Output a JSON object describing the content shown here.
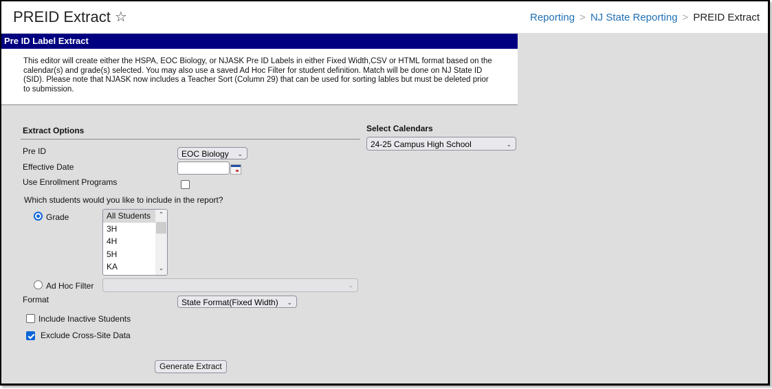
{
  "header": {
    "title": "PREID Extract",
    "favorite_icon": "star-outline-icon",
    "breadcrumb": [
      {
        "label": "Reporting",
        "link": true
      },
      {
        "label": "NJ State Reporting",
        "link": true
      },
      {
        "label": "PREID Extract",
        "link": false
      }
    ],
    "breadcrumb_separator": ">"
  },
  "banner": {
    "title": "Pre ID Label Extract"
  },
  "description": "This editor will create either the HSPA, EOC Biology, or NJASK Pre ID Labels in either Fixed Width,CSV or HTML format based on the calendar(s) and grade(s) selected. You may also use a saved Ad Hoc Filter for student definition. Match will be done on NJ State ID (SID). Please note that NJASK now includes a Teacher Sort (Column 29) that can be used for sorting lables but must be deleted prior to submission.",
  "extract_options": {
    "title": "Extract Options",
    "pre_id": {
      "label": "Pre ID",
      "value": "EOC Biology"
    },
    "effective_date": {
      "label": "Effective Date",
      "value": "",
      "icon": "calendar-icon"
    },
    "use_enrollment_programs": {
      "label": "Use Enrollment Programs",
      "checked": false
    },
    "students_question": "Which students would you like to include in the report?",
    "grade": {
      "label": "Grade",
      "selected": true,
      "options": [
        "All Students",
        "3H",
        "4H",
        "5H",
        "KA"
      ],
      "selected_option": "All Students"
    },
    "ad_hoc_filter": {
      "label": "Ad Hoc Filter",
      "selected": false,
      "value": ""
    },
    "format": {
      "label": "Format",
      "value": "State Format(Fixed Width)"
    },
    "include_inactive": {
      "label": "Include Inactive Students",
      "checked": false
    },
    "exclude_cross_site": {
      "label": "Exclude Cross-Site Data",
      "checked": true
    },
    "generate_button": "Generate Extract"
  },
  "calendars": {
    "title": "Select Calendars",
    "value": "24-25 Campus High School"
  },
  "colors": {
    "banner_bg": "#000080",
    "link": "#1f6fb5",
    "accent": "#0b64d8",
    "panel_bg": "#dedede"
  }
}
